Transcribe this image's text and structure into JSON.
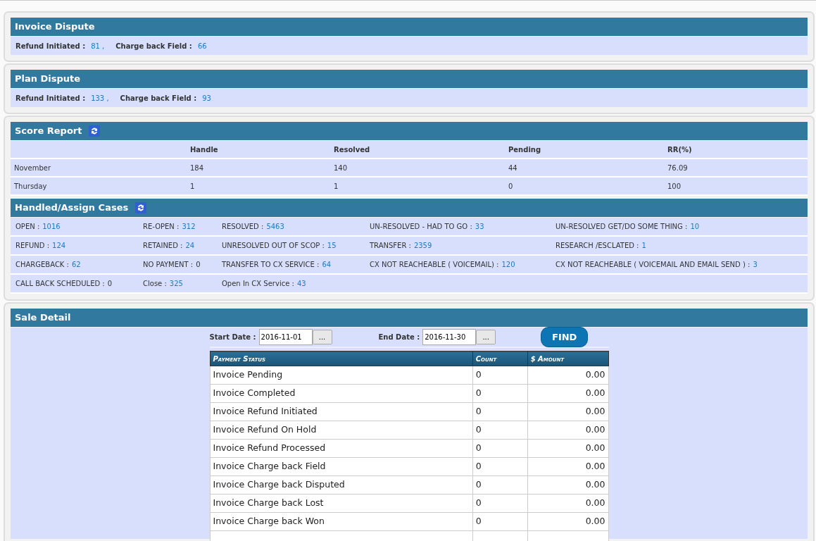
{
  "disputes": [
    {
      "title": "Invoice Dispute",
      "items": [
        {
          "label": "Refund Initiated :",
          "value": "81 ,"
        },
        {
          "label": "Charge back Field :",
          "value": "66"
        }
      ]
    },
    {
      "title": "Plan Dispute",
      "items": [
        {
          "label": "Refund Initiated :",
          "value": "133 ,"
        },
        {
          "label": "Charge back Field :",
          "value": "93"
        }
      ]
    }
  ],
  "score_report": {
    "title": "Score Report",
    "columns": [
      "Handle",
      "Resolved",
      "Pending",
      "RR(%)"
    ],
    "rows": [
      {
        "label": "November",
        "cells": [
          "184",
          "140",
          "44",
          "76.09"
        ]
      },
      {
        "label": "Thursday",
        "cells": [
          "1",
          "1",
          "0",
          "100"
        ]
      }
    ]
  },
  "cases": {
    "title": "Handled/Assign Cases",
    "rows": [
      [
        {
          "label": "OPEN :",
          "value": "1016",
          "link": true
        },
        {
          "label": "RE-OPEN :",
          "value": "312",
          "link": true
        },
        {
          "label": "RESOLVED :",
          "value": "5463",
          "link": true
        },
        {
          "label": "UN-RESOLVED - HAD TO GO :",
          "value": "33",
          "link": true
        },
        {
          "label": "UN-RESOLVED GET/DO SOME THING :",
          "value": "10",
          "link": true
        }
      ],
      [
        {
          "label": "REFUND :",
          "value": "124",
          "link": true
        },
        {
          "label": "RETAINED :",
          "value": "24",
          "link": true
        },
        {
          "label": "UNRESOLVED OUT OF SCOP :",
          "value": "15",
          "link": true
        },
        {
          "label": "TRANSFER :",
          "value": "2359",
          "link": true
        },
        {
          "label": "RESEARCH /ESCLATED :",
          "value": "1",
          "link": true
        }
      ],
      [
        {
          "label": "CHARGEBACK :",
          "value": "62",
          "link": true
        },
        {
          "label": "NO PAYMENT :",
          "value": "0",
          "link": false
        },
        {
          "label": "TRANSFER TO CX SERVICE :",
          "value": "64",
          "link": true
        },
        {
          "label": "CX NOT REACHEABLE ( VOICEMAIL) :",
          "value": "120",
          "link": true
        },
        {
          "label": "CX NOT REACHEABLE ( VOICEMAIL AND EMAIL SEND ) :",
          "value": "3",
          "link": true
        }
      ],
      [
        {
          "label": "CALL BACK SCHEDULED :",
          "value": "0",
          "link": false
        },
        {
          "label": "Close :",
          "value": "325",
          "link": true
        },
        {
          "label": "Open In CX Service :",
          "value": "43",
          "link": true
        }
      ]
    ]
  },
  "sale_detail": {
    "title": "Sale Detail",
    "start_date": {
      "label": "Start Date :",
      "value": "2016-11-01",
      "picker": "..."
    },
    "end_date": {
      "label": "End Date :",
      "value": "2016-11-30",
      "picker": "..."
    },
    "find_button": "FIND",
    "table": {
      "columns": [
        "Payment Status",
        "Count",
        "$ Amount"
      ],
      "rows": [
        [
          "Invoice Pending",
          "0",
          "0.00"
        ],
        [
          "Invoice Completed",
          "0",
          "0.00"
        ],
        [
          "Invoice Refund Initiated",
          "0",
          "0.00"
        ],
        [
          "Invoice Refund On Hold",
          "0",
          "0.00"
        ],
        [
          "Invoice Refund Processed",
          "0",
          "0.00"
        ],
        [
          "Invoice Charge back Field",
          "0",
          "0.00"
        ],
        [
          "Invoice Charge back Disputed",
          "0",
          "0.00"
        ],
        [
          "Invoice Charge back Lost",
          "0",
          "0.00"
        ],
        [
          "Invoice Charge back Won",
          "0",
          "0.00"
        ]
      ]
    }
  }
}
